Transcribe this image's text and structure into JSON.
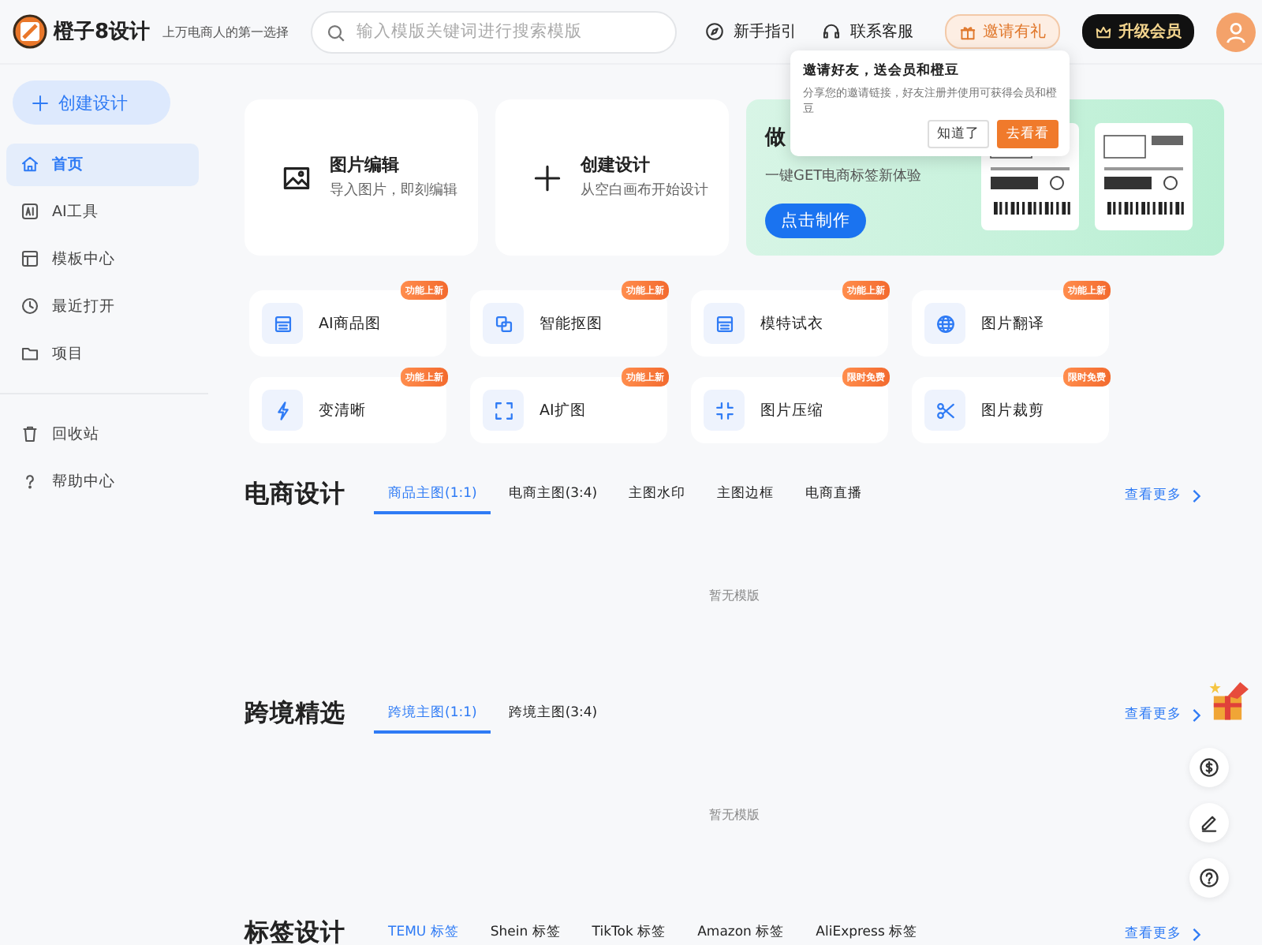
{
  "header": {
    "brand": "橙子8设计",
    "slogan": "上万电商人的第一选择",
    "search": {
      "placeholder": "输入模版关键词进行搜索模版"
    },
    "links": [
      {
        "label": "新手指引"
      },
      {
        "label": "联系客服"
      }
    ],
    "invite_button": "邀请有礼",
    "upgrade_button": "升级会员"
  },
  "popover": {
    "title": "邀请好友，送会员和橙豆",
    "text": "分享您的邀请链接，好友注册并使用可获得会员和橙豆",
    "buttons": [
      {
        "label": "知道了",
        "kind": "secondary"
      },
      {
        "label": "去看看",
        "kind": "primary"
      }
    ]
  },
  "sidebar": {
    "create_button": "创建设计",
    "items": [
      {
        "label": "首页",
        "selected": true
      },
      {
        "label": "AI工具",
        "selected": false
      },
      {
        "label": "模板中心",
        "selected": false
      },
      {
        "label": "最近打开",
        "selected": false
      },
      {
        "label": "项目",
        "selected": false
      }
    ],
    "bottom_items": [
      {
        "label": "回收站",
        "selected": false
      },
      {
        "label": "帮助中心",
        "selected": false
      }
    ]
  },
  "quick_cards": [
    {
      "title": "图片编辑",
      "description": "导入图片，即刻编辑"
    },
    {
      "title": "创建设计",
      "description": "从空白画布开始设计"
    }
  ],
  "banner": {
    "title": "做",
    "subtitle": "一键GET电商标签新体验",
    "button": "点击制作"
  },
  "tools": [
    {
      "label": "AI商品图",
      "badge": "功能上新"
    },
    {
      "label": "智能抠图",
      "badge": "功能上新"
    },
    {
      "label": "模特试衣",
      "badge": "功能上新"
    },
    {
      "label": "图片翻译",
      "badge": "功能上新"
    },
    {
      "label": "变清晰",
      "badge": "功能上新"
    },
    {
      "label": "AI扩图",
      "badge": "功能上新"
    },
    {
      "label": "图片压缩",
      "badge": "限时免费"
    },
    {
      "label": "图片裁剪",
      "badge": "限时免费"
    }
  ],
  "sections": [
    {
      "title": "电商设计",
      "tabs": [
        {
          "label": "商品主图(1:1)",
          "selected": true
        },
        {
          "label": "电商主图(3:4)",
          "selected": false
        },
        {
          "label": "主图水印",
          "selected": false
        },
        {
          "label": "主图边框",
          "selected": false
        },
        {
          "label": "电商直播",
          "selected": false
        }
      ],
      "more": "查看更多",
      "empty": "暂无模版"
    },
    {
      "title": "跨境精选",
      "tabs": [
        {
          "label": "跨境主图(1:1)",
          "selected": true
        },
        {
          "label": "跨境主图(3:4)",
          "selected": false
        }
      ],
      "more": "查看更多",
      "empty": "暂无模版"
    },
    {
      "title": "标签设计",
      "tabs": [
        {
          "label": "TEMU 标签",
          "selected": true
        },
        {
          "label": "Shein 标签",
          "selected": false
        },
        {
          "label": "TikTok 标签",
          "selected": false
        },
        {
          "label": "Amazon 标签",
          "selected": false
        },
        {
          "label": "AliExpress 标签",
          "selected": false
        }
      ],
      "more": "查看更多"
    }
  ]
}
